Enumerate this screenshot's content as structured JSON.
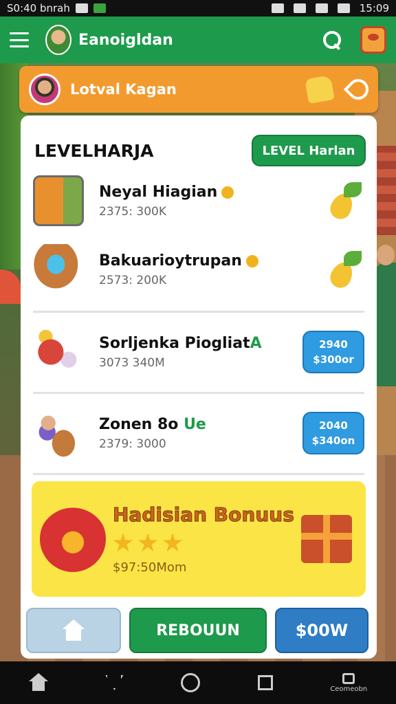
{
  "status_bar": {
    "left_text": "S0:40 bnrah",
    "time": "15:09"
  },
  "app_bar": {
    "title": "Eanoigldan"
  },
  "banner": {
    "title": "Lotval Kagan"
  },
  "card": {
    "title": "LEVELHARJA",
    "level_button": "LEVEL Harlan",
    "items": [
      {
        "name": "Neyal Hiagian",
        "name_highlight": "",
        "sub": "2375: 300K"
      },
      {
        "name": "Bakuarioytrupan",
        "name_highlight": "",
        "sub": "2573: 200K"
      },
      {
        "name": "Sorljenka Piogliat",
        "name_highlight": "A",
        "sub": "3073 340M",
        "badge_top": "2940",
        "badge_bottom": "$300or"
      },
      {
        "name": "Zonen 8o ",
        "name_highlight": "Ue",
        "sub": "2379: 3000",
        "badge_top": "2040",
        "badge_bottom": "$340on"
      }
    ]
  },
  "bonus": {
    "title": "Hadisian Bonuus",
    "sub": "$97:50Mom",
    "stars": 3
  },
  "buttons": {
    "reboun": "REBOUUN",
    "now": "$00W"
  },
  "nav": {
    "corner_label": "Ceomeobn"
  }
}
